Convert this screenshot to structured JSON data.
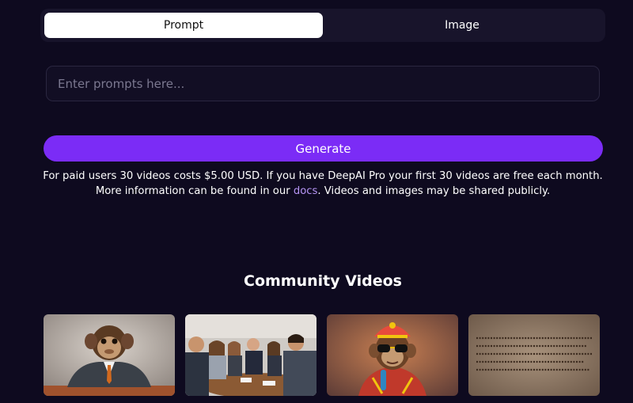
{
  "tabs": [
    {
      "label": "Prompt",
      "active": true
    },
    {
      "label": "Image",
      "active": false
    }
  ],
  "prompt": {
    "placeholder": "Enter prompts here...",
    "value": ""
  },
  "generate": {
    "label": "Generate",
    "color": "#7b2cf6"
  },
  "info": {
    "text_before": "For paid users 30 videos costs $5.00 USD. If you have DeepAI Pro your first 30 videos are free each month. More information can be found in our ",
    "link_label": "docs",
    "text_after": ". Videos and images may be shared publicly."
  },
  "community": {
    "title": "Community Videos",
    "videos": [
      {
        "icon": "monkey-in-suit-thumbnail"
      },
      {
        "icon": "business-meeting-thumbnail"
      },
      {
        "icon": "monkey-with-sunglasses-thumbnail"
      },
      {
        "icon": "ancient-text-tablet-thumbnail"
      }
    ]
  },
  "colors": {
    "background": "#0e0a1f",
    "accent": "#7b2cf6",
    "link": "#b695f5"
  }
}
